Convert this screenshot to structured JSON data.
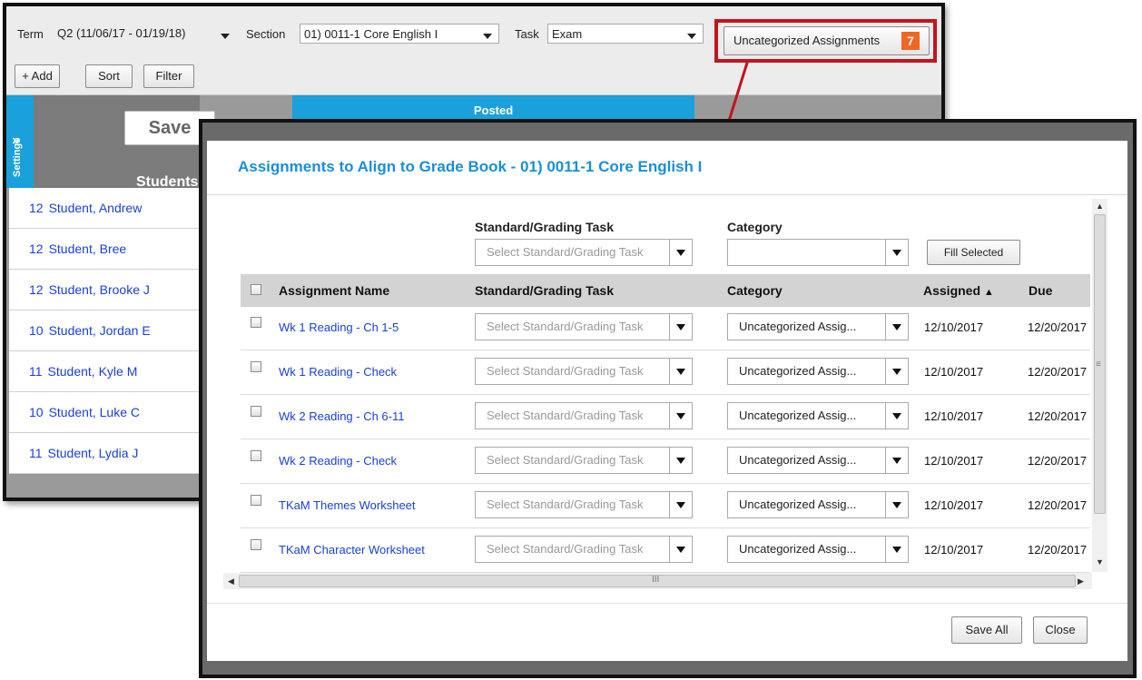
{
  "toolbar": {
    "term_label": "Term",
    "term_value": "Q2 (11/06/17 - 01/19/18)",
    "section_label": "Section",
    "section_value": "01) 0011-1 Core English I",
    "task_label": "Task",
    "task_value": "Exam",
    "uncategorized_label": "Uncategorized Assignments",
    "uncategorized_count": "7",
    "add_label": "+ Add",
    "sort_label": "Sort",
    "filter_label": "Filter"
  },
  "gradebook": {
    "settings_label": "Settings",
    "save_label": "Save",
    "students_label": "Students",
    "posted_label": "Posted",
    "students": [
      {
        "grade": "12",
        "name": "Student, Andrew"
      },
      {
        "grade": "12",
        "name": "Student, Bree"
      },
      {
        "grade": "12",
        "name": "Student, Brooke J"
      },
      {
        "grade": "10",
        "name": "Student, Jordan E"
      },
      {
        "grade": "11",
        "name": "Student, Kyle M"
      },
      {
        "grade": "10",
        "name": "Student, Luke C"
      },
      {
        "grade": "11",
        "name": "Student, Lydia J"
      }
    ]
  },
  "modal": {
    "title": "Assignments to Align to Grade Book - 01) 0011-1 Core English I",
    "filter_task_label": "Standard/Grading Task",
    "filter_task_placeholder": "Select Standard/Grading Task",
    "filter_category_label": "Category",
    "filter_category_value": "",
    "fill_selected_label": "Fill Selected",
    "columns": {
      "name": "Assignment Name",
      "task": "Standard/Grading Task",
      "category": "Category",
      "assigned": "Assigned",
      "due": "Due"
    },
    "rows": [
      {
        "name": "Wk 1 Reading - Ch 1-5",
        "task": "Select Standard/Grading Task",
        "category": "Uncategorized Assig...",
        "assigned": "12/10/2017",
        "due": "12/20/2017"
      },
      {
        "name": "Wk 1 Reading - Check",
        "task": "Select Standard/Grading Task",
        "category": "Uncategorized Assig...",
        "assigned": "12/10/2017",
        "due": "12/20/2017"
      },
      {
        "name": "Wk 2 Reading - Ch 6-11",
        "task": "Select Standard/Grading Task",
        "category": "Uncategorized Assig...",
        "assigned": "12/10/2017",
        "due": "12/20/2017"
      },
      {
        "name": "Wk 2 Reading - Check",
        "task": "Select Standard/Grading Task",
        "category": "Uncategorized Assig...",
        "assigned": "12/10/2017",
        "due": "12/20/2017"
      },
      {
        "name": "TKaM Themes Worksheet",
        "task": "Select Standard/Grading Task",
        "category": "Uncategorized Assig...",
        "assigned": "12/10/2017",
        "due": "12/20/2017"
      },
      {
        "name": "TKaM Character Worksheet",
        "task": "Select Standard/Grading Task",
        "category": "Uncategorized Assig...",
        "assigned": "12/10/2017",
        "due": "12/20/2017"
      }
    ],
    "save_all_label": "Save All",
    "close_label": "Close"
  },
  "colors": {
    "accent_blue": "#1aa1dc",
    "highlight_red": "#c2141d",
    "badge_orange": "#f26522",
    "link_blue": "#1a3fd6"
  }
}
